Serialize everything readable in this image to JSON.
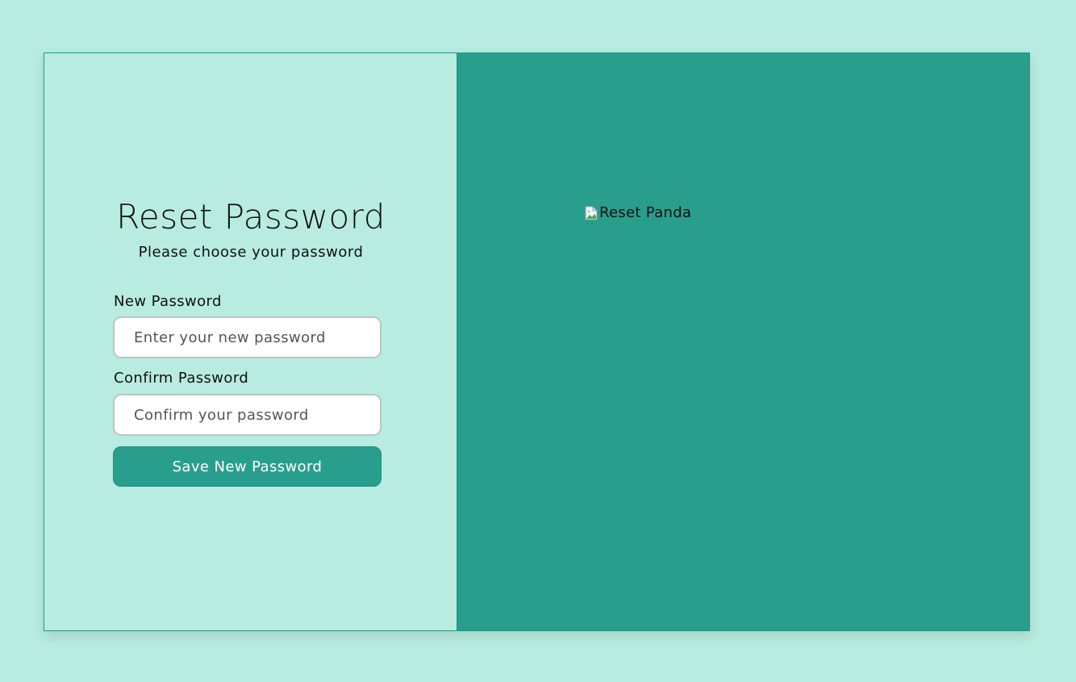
{
  "left": {
    "title": "Reset Password",
    "subtitle": "Please choose your password",
    "new_password": {
      "label": "New Password",
      "placeholder": "Enter your new password",
      "value": ""
    },
    "confirm_password": {
      "label": "Confirm Password",
      "placeholder": "Confirm your password",
      "value": ""
    },
    "save_button_label": "Save New Password"
  },
  "right": {
    "image_alt": "Reset Panda",
    "image_icon": "broken-image-icon"
  },
  "colors": {
    "background": "#b8ece0",
    "accent": "#299e8d",
    "border": "#1e9b87",
    "button_text": "#ffffff"
  }
}
